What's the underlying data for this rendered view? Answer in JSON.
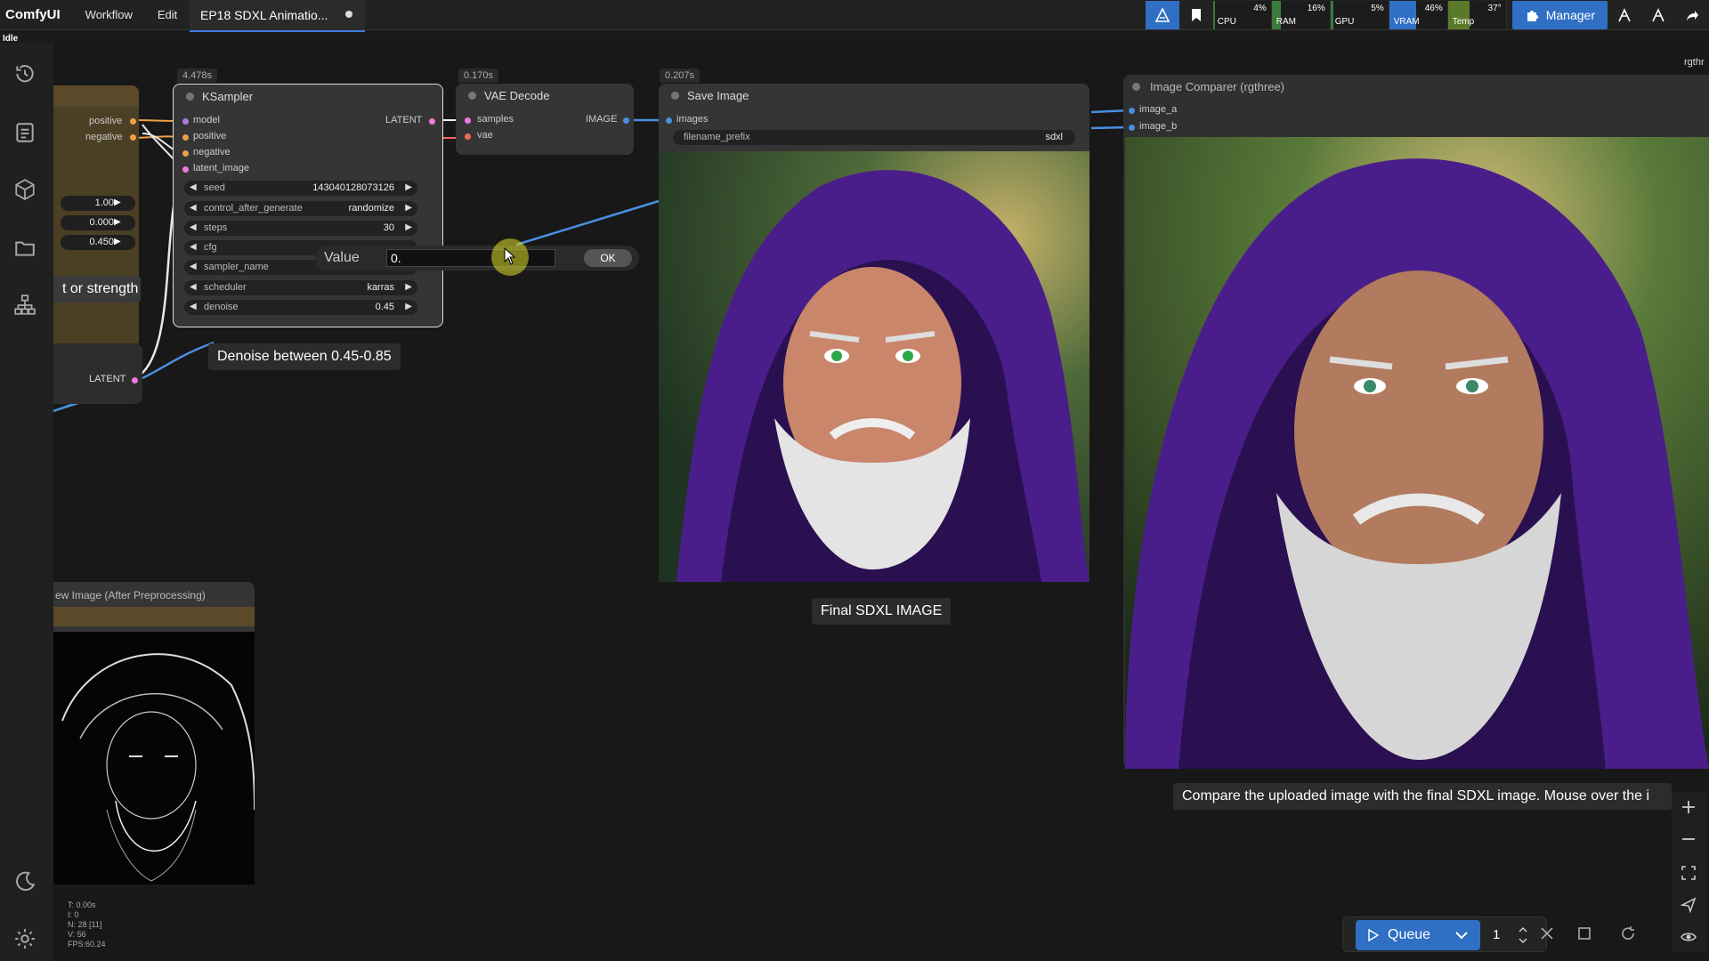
{
  "topbar": {
    "logo": "ComfyUI",
    "menu": [
      "Workflow",
      "Edit"
    ],
    "workflow_tab": "EP18 SDXL Animatio...",
    "stats": [
      {
        "label": "CPU",
        "percent": "4%",
        "value": 4,
        "color": "#3a7a3a"
      },
      {
        "label": "RAM",
        "percent": "16%",
        "value": 16,
        "color": "#3a7a3a"
      },
      {
        "label": "GPU",
        "percent": "5%",
        "value": 5,
        "color": "#3a7a3a"
      },
      {
        "label": "VRAM",
        "percent": "46%",
        "value": 46,
        "color": "#2f6fc4"
      },
      {
        "label": "Temp",
        "percent": "37°",
        "value": 37,
        "color": "#5a7a2a"
      }
    ],
    "manager_label": "Manager"
  },
  "status": "Idle",
  "left_node": {
    "inputs": [
      "positive",
      "negative"
    ],
    "values": [
      "1.00",
      "0.000",
      "0.450"
    ],
    "partial_label": "t or strength",
    "latent_label": "LATENT"
  },
  "ksampler": {
    "timing": "4.478s",
    "title": "KSampler",
    "inputs": [
      "model",
      "positive",
      "negative",
      "latent_image"
    ],
    "output": "LATENT",
    "widgets": [
      {
        "name": "seed",
        "value": "143040128073126"
      },
      {
        "name": "control_after_generate",
        "value": "randomize"
      },
      {
        "name": "steps",
        "value": "30"
      },
      {
        "name": "cfg",
        "value": ""
      },
      {
        "name": "sampler_name",
        "value": ""
      },
      {
        "name": "scheduler",
        "value": "karras"
      },
      {
        "name": "denoise",
        "value": "0.45"
      }
    ]
  },
  "value_dialog": {
    "label": "Value",
    "value": "0.",
    "ok": "OK"
  },
  "vae_decode": {
    "timing": "0.170s",
    "title": "VAE Decode",
    "inputs": [
      "samples",
      "vae"
    ],
    "output": "IMAGE"
  },
  "save_image": {
    "timing": "0.207s",
    "title": "Save Image",
    "input": "images",
    "widget_name": "filename_prefix",
    "widget_value": "sdxl"
  },
  "image_comparer": {
    "title": "Image Comparer (rgthree)",
    "inputs": [
      "image_a",
      "image_b"
    ],
    "corner_text": "rgthr"
  },
  "preview_node": {
    "title": "ew Image (After Preprocessing)"
  },
  "tooltips": {
    "denoise": "Denoise between 0.45-0.85",
    "final": "Final SDXL IMAGE",
    "compare": "Compare the uploaded image with the final SDXL image. Mouse over the i"
  },
  "queue": {
    "label": "Queue",
    "count": "1"
  },
  "stats_overlay": [
    "T: 0.00s",
    "I: 0",
    "N: 28 [11]",
    "V: 56",
    "FPS:60.24"
  ],
  "colors": {
    "accent": "#2f6fc4",
    "purple_hood": "#6a2fb0"
  }
}
